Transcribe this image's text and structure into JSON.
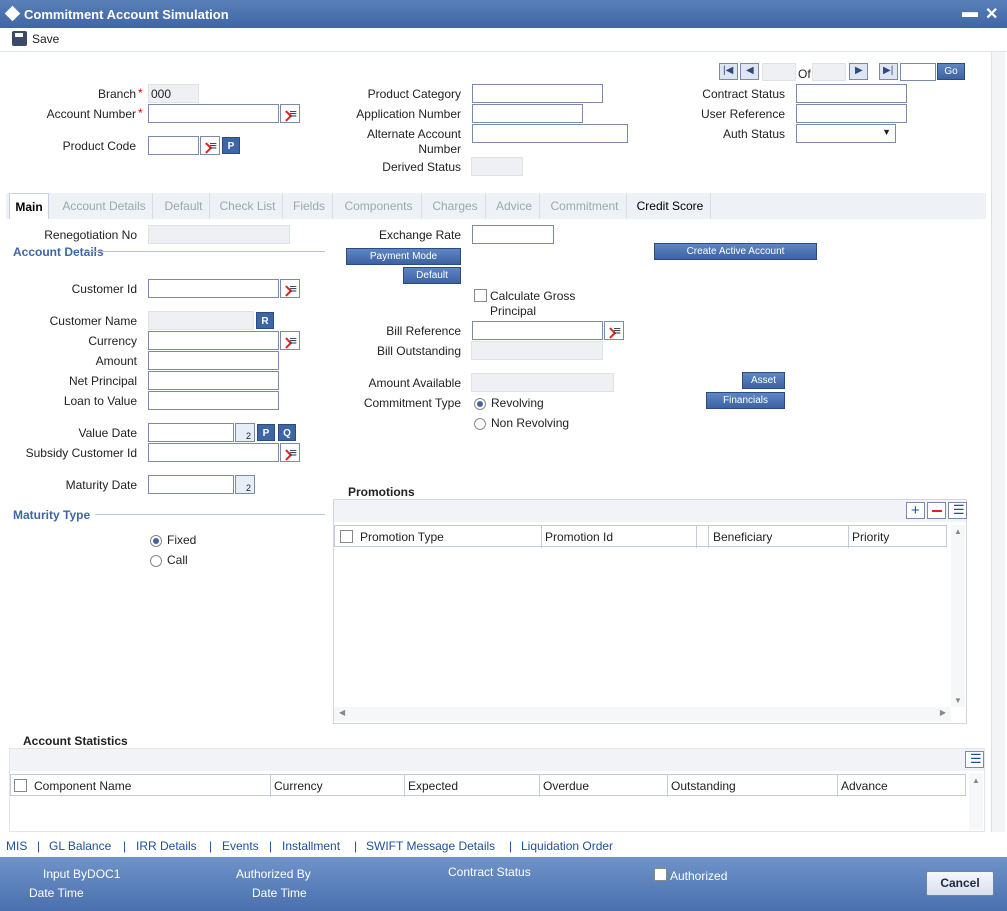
{
  "window": {
    "title": "Commitment Account Simulation",
    "minimize": "▬",
    "close": "✕"
  },
  "toolbar": {
    "save_label": "Save"
  },
  "nav": {
    "of_label": "Of",
    "go_label": "Go"
  },
  "header": {
    "branch_label": "Branch",
    "branch_value": "000",
    "account_number_label": "Account Number",
    "product_code_label": "Product Code",
    "product_category_label": "Product Category",
    "application_number_label": "Application Number",
    "alternate_account_label_1": "Alternate Account",
    "alternate_account_label_2": "Number",
    "derived_status_label": "Derived Status",
    "contract_status_label": "Contract Status",
    "user_reference_label": "User Reference",
    "auth_status_label": "Auth Status"
  },
  "tabs": [
    "Main",
    "Account Details",
    "Default",
    "Check List",
    "Fields",
    "Components",
    "Charges",
    "Advice",
    "Commitment",
    "Credit Score"
  ],
  "main": {
    "renegotiation_no_label": "Renegotiation No",
    "account_details_heading": "Account Details",
    "customer_id_label": "Customer Id",
    "customer_name_label": "Customer Name",
    "currency_label": "Currency",
    "amount_label": "Amount",
    "net_principal_label": "Net Principal",
    "loan_to_value_label": "Loan to Value",
    "value_date_label": "Value Date",
    "subsidy_customer_id_label": "Subsidy Customer Id",
    "maturity_date_label": "Maturity Date",
    "maturity_type_heading": "Maturity Type",
    "maturity_fixed": "Fixed",
    "maturity_call": "Call",
    "exchange_rate_label": "Exchange Rate",
    "payment_mode_button": "Payment Mode",
    "default_button": "Default",
    "calc_gross_label_1": "Calculate Gross",
    "calc_gross_label_2": "Principal",
    "bill_reference_label": "Bill Reference",
    "bill_outstanding_label": "Bill Outstanding",
    "amount_available_label": "Amount Available",
    "commitment_type_label": "Commitment Type",
    "revolving_label": "Revolving",
    "non_revolving_label": "Non Revolving",
    "create_active_account_button": "Create Active Account",
    "asset_button": "Asset",
    "financials_button": "Financials",
    "p_btn": "P",
    "q_btn": "Q",
    "r_btn": "R"
  },
  "promotions": {
    "heading": "Promotions",
    "columns": [
      "Promotion Type",
      "Promotion Id",
      "Beneficiary",
      "Priority"
    ]
  },
  "account_statistics": {
    "heading": "Account Statistics",
    "columns": [
      "Component Name",
      "Currency",
      "Expected",
      "Overdue",
      "Outstanding",
      "Advance"
    ]
  },
  "footer_links": [
    "MIS",
    "GL Balance",
    "IRR Details",
    "Events",
    "Installment",
    "SWIFT Message Details",
    "Liquidation Order"
  ],
  "footer": {
    "input_by": "Input ByDOC1",
    "date_time_1": "Date Time",
    "authorized_by": "Authorized By",
    "date_time_2": "Date Time",
    "contract_status": "Contract Status",
    "authorized": "Authorized",
    "cancel": "Cancel"
  }
}
